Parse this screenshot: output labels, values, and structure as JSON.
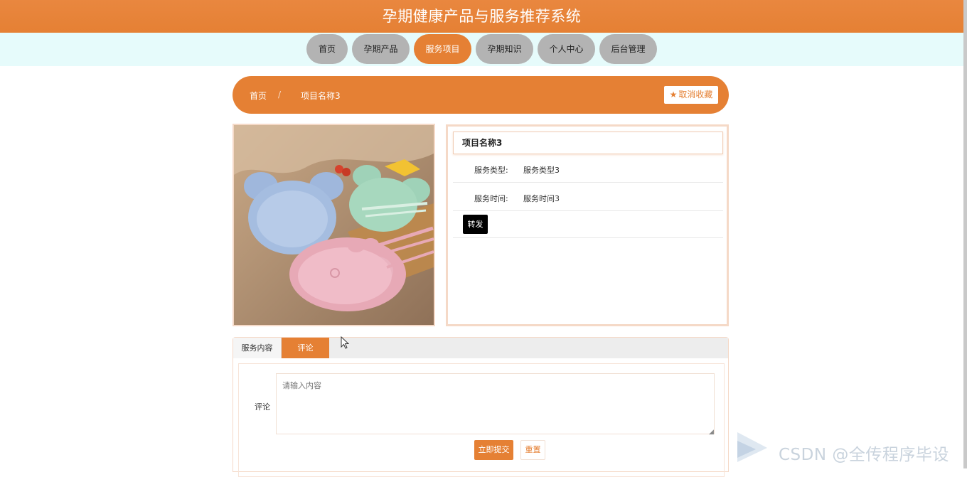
{
  "header": {
    "title": "孕期健康产品与服务推荐系统"
  },
  "nav": [
    {
      "label": "首页",
      "active": false
    },
    {
      "label": "孕期产品",
      "active": false
    },
    {
      "label": "服务项目",
      "active": true
    },
    {
      "label": "孕期知识",
      "active": false
    },
    {
      "label": "个人中心",
      "active": false
    },
    {
      "label": "后台管理",
      "active": false
    }
  ],
  "breadcrumb": {
    "home": "首页",
    "separator": "/",
    "current": "项目名称3"
  },
  "favorite": {
    "label": "取消收藏",
    "icon": "star-icon"
  },
  "detail": {
    "title": "项目名称3",
    "fields": [
      {
        "key": "服务类型:",
        "value": "服务类型3"
      },
      {
        "key": "服务时间:",
        "value": "服务时间3"
      }
    ],
    "share_label": "转发"
  },
  "tabs": [
    {
      "label": "服务内容",
      "active": false
    },
    {
      "label": "评论",
      "active": true
    }
  ],
  "comment_form": {
    "label": "评论",
    "placeholder": "请输入内容",
    "submit_label": "立即提交",
    "reset_label": "重置"
  },
  "watermark": {
    "text": "CSDN @全传程序毕设"
  },
  "colors": {
    "accent": "#e58034",
    "nav_inactive": "#b3b3b3",
    "nav_bar_bg": "#e6fbfb",
    "border": "#f5d9c7"
  }
}
